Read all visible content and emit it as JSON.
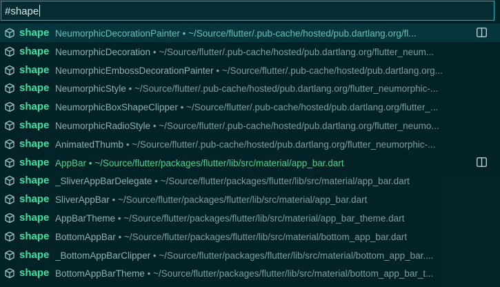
{
  "search": {
    "value": "#shape"
  },
  "results": [
    {
      "keyword": "shape",
      "name": "NeumorphicDecorationPainter",
      "separator": " • ",
      "path": "~/Source/flutter/.pub-cache/hosted/pub.dartlang.org/fl...",
      "selected": true,
      "split_icon": true
    },
    {
      "keyword": "shape",
      "name": "NeumorphicDecoration",
      "separator": " • ",
      "path": "~/Source/flutter/.pub-cache/hosted/pub.dartlang.org/flutter_neum..."
    },
    {
      "keyword": "shape",
      "name": "NeumorphicEmbossDecorationPainter",
      "separator": " • ",
      "path": "~/Source/flutter/.pub-cache/hosted/pub.dartlang.org..."
    },
    {
      "keyword": "shape",
      "name": "NeumorphicStyle",
      "separator": " • ",
      "path": "~/Source/flutter/.pub-cache/hosted/pub.dartlang.org/flutter_neumorphic-..."
    },
    {
      "keyword": "shape",
      "name": "NeumorphicBoxShapeClipper",
      "separator": " • ",
      "path": "~/Source/flutter/.pub-cache/hosted/pub.dartlang.org/flutter_..."
    },
    {
      "keyword": "shape",
      "name": "NeumorphicRadioStyle",
      "separator": " • ",
      "path": "~/Source/flutter/.pub-cache/hosted/pub.dartlang.org/flutter_neumo..."
    },
    {
      "keyword": "shape",
      "name": "AnimatedThumb",
      "separator": " • ",
      "path": "~/Source/flutter/.pub-cache/hosted/pub.dartlang.org/flutter_neumorphic-..."
    },
    {
      "keyword": "shape",
      "name": "AppBar",
      "separator": " • ",
      "path": "~/Source/flutter/packages/flutter/lib/src/material/app_bar.dart",
      "active": true,
      "split_icon": true
    },
    {
      "keyword": "shape",
      "name": "_SliverAppBarDelegate",
      "separator": " • ",
      "path": "~/Source/flutter/packages/flutter/lib/src/material/app_bar.dart"
    },
    {
      "keyword": "shape",
      "name": "SliverAppBar",
      "separator": " • ",
      "path": "~/Source/flutter/packages/flutter/lib/src/material/app_bar.dart"
    },
    {
      "keyword": "shape",
      "name": "AppBarTheme",
      "separator": " • ",
      "path": "~/Source/flutter/packages/flutter/lib/src/material/app_bar_theme.dart"
    },
    {
      "keyword": "shape",
      "name": "BottomAppBar",
      "separator": " • ",
      "path": "~/Source/flutter/packages/flutter/lib/src/material/bottom_app_bar.dart"
    },
    {
      "keyword": "shape",
      "name": "_BottomAppBarClipper",
      "separator": " • ",
      "path": "~/Source/flutter/packages/flutter/lib/src/material/bottom_app_bar...."
    },
    {
      "keyword": "shape",
      "name": "BottomAppBarTheme",
      "separator": " • ",
      "path": "~/Source/flutter/packages/flutter/lib/src/material/bottom_app_bar_t..."
    }
  ],
  "icons": {
    "symbol": "cube-symbol-icon",
    "split": "split-editor-icon"
  },
  "colors": {
    "keyword": "#3fe0a0",
    "active_item": "#4fd089",
    "input_border": "#1fb4c4",
    "background": "#032227"
  }
}
